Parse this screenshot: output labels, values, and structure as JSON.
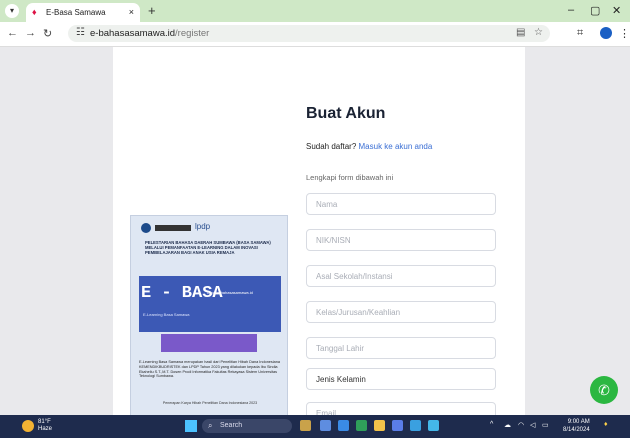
{
  "browser": {
    "tab_title": "E-Basa Samawa",
    "tab_close": "×",
    "new_tab": "+",
    "url_domain": "e-bahasasamawa.id",
    "url_path": "/register",
    "window_controls": {
      "minimize": "–",
      "maximize": "▢",
      "close": "✕"
    }
  },
  "form": {
    "heading": "Buat Akun",
    "signin_prompt": "Sudah daftar?",
    "signin_link": "Masuk ke akun anda",
    "instruction": "Lengkapi form dibawah ini",
    "fields": [
      {
        "placeholder": "Nama"
      },
      {
        "placeholder": "NIK/NISN"
      },
      {
        "placeholder": "Asal Sekolah/Instansi"
      },
      {
        "placeholder": "Kelas/Jurusan/Keahlian"
      },
      {
        "placeholder": "Tanggal Lahir"
      },
      {
        "value": "Jenis Kelamin"
      },
      {
        "placeholder": "Email"
      }
    ]
  },
  "poster": {
    "logo_text": "lpdp",
    "heading": "PELESTARIAN BAHASA DAERAH SUMBAWA (BASA SAMAWA) MELALUI PEMANFAATAN E-LEARNING DALAM INOVASI PEMBELAJARAN BAGI ANAK USIA REMAJA",
    "title": "E - BASA",
    "site": "http://e-bahasasamawa.id",
    "tagline": "E-Learning Basa Samawa",
    "body": "E-Learning Basa Samawa merupakan hasil dari Penelitian Hibah Dana Indonesiana KEMENDIKBUDRISTEK dan LPDP Tahun 2023 yang dilakukan kepada Ibu Sindia Ekaheliu S.T.,M.T. Dosen Prodi Informatika Fakultas Rekayasa Sistem Universitas Teknologi Sumbawa.",
    "footer": "Penerapan Karya Hibah Penelitian Dana Indonesiana 2023"
  },
  "taskbar": {
    "temperature": "81°F",
    "condition": "Haze",
    "search_label": "Search",
    "time": "9:00 AM",
    "date": "8/14/2024"
  },
  "colors": {
    "accent_link": "#3b6fd4",
    "tab_bar": "#cfe8c6",
    "whatsapp": "#2bb741",
    "taskbar": "#1e2b4d"
  }
}
